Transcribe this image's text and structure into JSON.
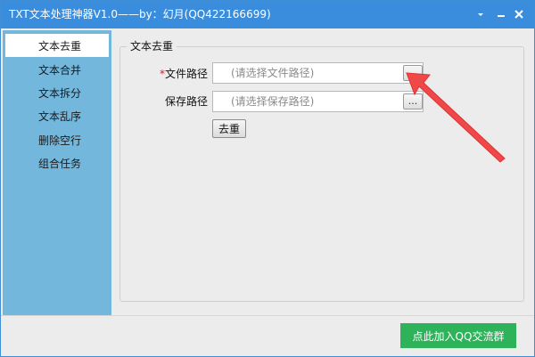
{
  "window": {
    "title": "TXT文本处理神器V1.0——by：幻月(QQ422166699)",
    "accent_color": "#3a8ddd"
  },
  "titlebar_controls": {
    "menu_icon": "dropdown-triangle-icon",
    "minimize_icon": "minimize-icon",
    "close_icon": "close-icon"
  },
  "sidebar": {
    "color": "#74b7dc",
    "items": [
      {
        "label": "文本去重",
        "active": true
      },
      {
        "label": "文本合并",
        "active": false
      },
      {
        "label": "文本拆分",
        "active": false
      },
      {
        "label": "文本乱序",
        "active": false
      },
      {
        "label": "删除空行",
        "active": false
      },
      {
        "label": "组合任务",
        "active": false
      }
    ]
  },
  "main": {
    "group_title": "文本去重",
    "file_path": {
      "required_mark": "*",
      "label": "文件路径",
      "value": "",
      "placeholder": "(请选择文件路径)",
      "browse_label": "..."
    },
    "save_path": {
      "label": "保存路径",
      "value": "",
      "placeholder": "(请选择保存路径)",
      "browse_label": "..."
    },
    "dedupe_button": "去重"
  },
  "footer": {
    "join_qq_button": "点此加入QQ交流群",
    "button_color": "#2fb35a"
  },
  "annotation": {
    "arrow_color": "#f04848"
  }
}
